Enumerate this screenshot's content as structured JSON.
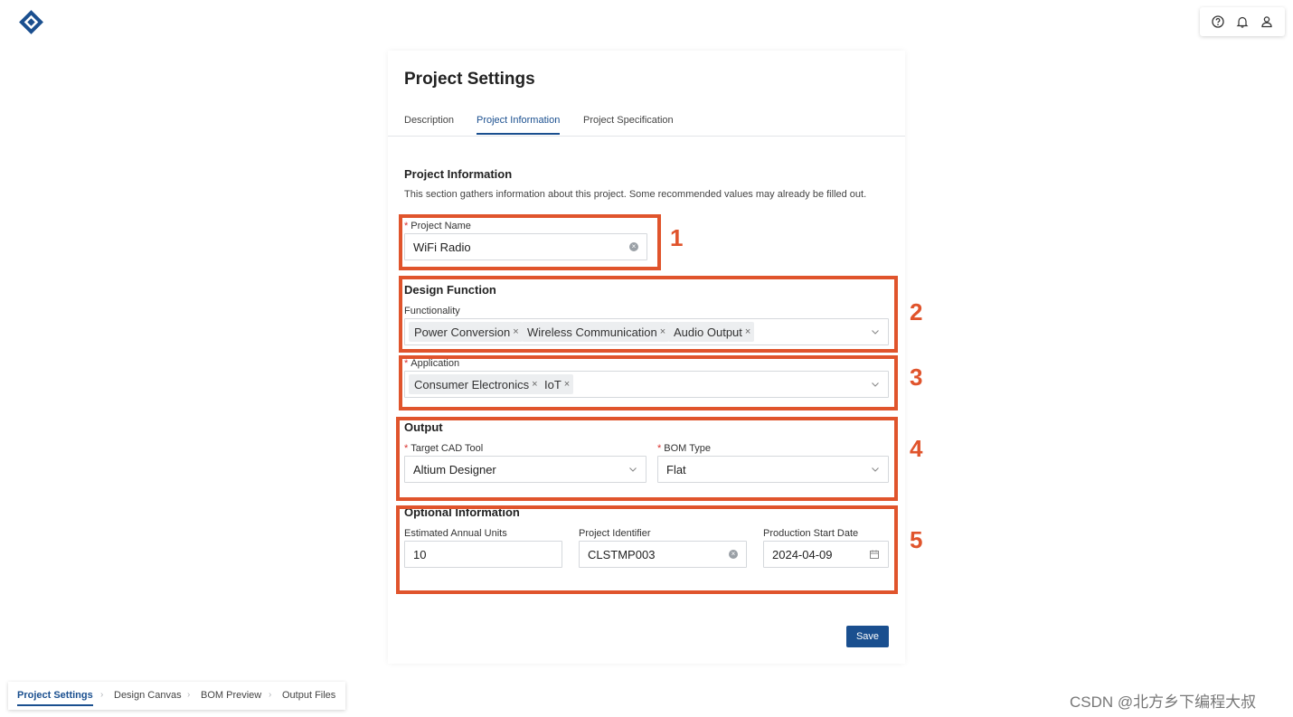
{
  "header": {
    "logo_icon": "diamond-logo-icon",
    "help_icon": "help-circle-icon",
    "bell_icon": "bell-icon",
    "user_icon": "user-icon"
  },
  "card": {
    "title": "Project Settings",
    "tabs": [
      "Description",
      "Project Information",
      "Project Specification"
    ],
    "active_tab": "Project Information"
  },
  "project_info": {
    "title": "Project Information",
    "description": "This section gathers information about this project. Some recommended values may already be filled out.",
    "project_name_label": "Project Name",
    "project_name_value": "WiFi Radio"
  },
  "design_function": {
    "title": "Design Function",
    "functionality_label": "Functionality",
    "functionality_tags": [
      "Power Conversion",
      "Wireless Communication",
      "Audio Output"
    ],
    "application_label": "Application",
    "application_tags": [
      "Consumer Electronics",
      "IoT"
    ]
  },
  "output": {
    "title": "Output",
    "cad_label": "Target CAD Tool",
    "cad_value": "Altium Designer",
    "bom_label": "BOM Type",
    "bom_value": "Flat"
  },
  "optional": {
    "title": "Optional Information",
    "units_label": "Estimated Annual Units",
    "units_value": "10",
    "identifier_label": "Project Identifier",
    "identifier_value": "CLSTMP003",
    "date_label": "Production Start Date",
    "date_value": "2024-04-09"
  },
  "actions": {
    "save_label": "Save"
  },
  "annotations": [
    "1",
    "2",
    "3",
    "4",
    "5"
  ],
  "annotation_color": "#e0542c",
  "accent_color": "#1a4f8f",
  "bottom_nav": {
    "items": [
      "Project Settings",
      "Design Canvas",
      "BOM Preview",
      "Output Files"
    ],
    "active": "Project Settings"
  },
  "watermark": "CSDN @北方乡下编程大叔"
}
